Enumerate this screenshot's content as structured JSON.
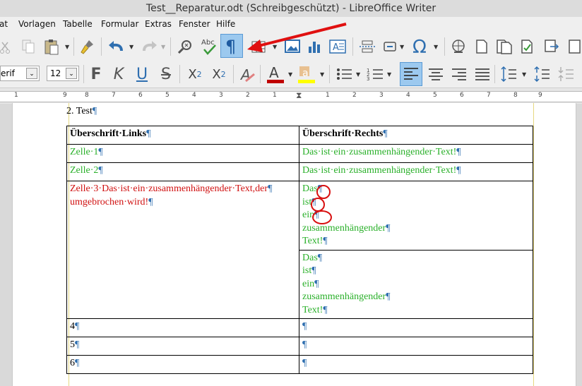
{
  "window": {
    "title": "Test__Reparatur.odt (Schreibgeschützt) - LibreOffice Writer"
  },
  "menu": {
    "items": [
      "at",
      "Vorlagen",
      "Tabelle",
      "Formular",
      "Extras",
      "Fenster",
      "Hilfe"
    ]
  },
  "font": {
    "name": "erif",
    "size": "12"
  },
  "ruler": {
    "numbers": [
      "1",
      "9",
      "8",
      "7",
      "6",
      "5",
      "4",
      "3",
      "2",
      "1",
      "1",
      "2",
      "3",
      "4",
      "5",
      "6",
      "7",
      "8",
      "9"
    ]
  },
  "document": {
    "heading": "2.   Test",
    "pilcrow": "¶",
    "table": {
      "header_left": "Überschrift·Links",
      "header_right": "Überschrift·Rechts",
      "row1_left": "Zelle·1",
      "row1_right": "Das·ist·ein·zusammenhängender·Text!",
      "row2_left": "Zelle·2",
      "row2_right": "Das·ist·ein·zusammenhängender·Text!",
      "row3_left_line1": "Zelle·3·Das·ist·ein·zusammenhängender·Text,der",
      "row3_left_line2": "umgebrochen·wird!",
      "row3_right_a": [
        "Das",
        "ist",
        "ein",
        "zusammenhängender",
        "Text!"
      ],
      "row3_right_b": [
        "Das",
        "ist",
        "ein",
        "zusammenhängender",
        "Text!"
      ],
      "row4_left": "4",
      "row5_left": "5",
      "row6_left": "6"
    }
  },
  "colors": {
    "green_text": "#2ab02a",
    "red_text": "#d01010",
    "pilcrow": "#2f6fb0",
    "annotation": "#e01010",
    "highlight_button": "#9cc9ef"
  }
}
